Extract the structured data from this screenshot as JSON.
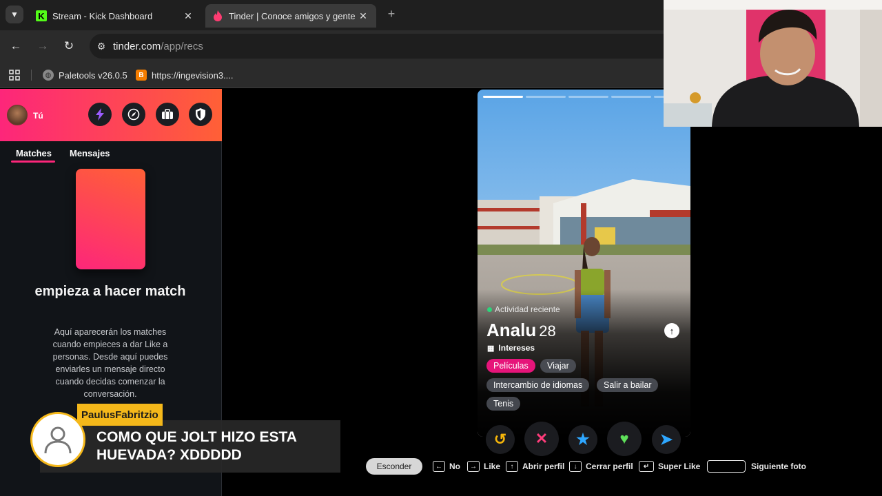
{
  "browser": {
    "tabs": [
      {
        "title": "Stream - Kick Dashboard",
        "favicon": "kick-icon",
        "active": false
      },
      {
        "title": "Tinder | Conoce amigos y gente",
        "favicon": "tinder-flame-icon",
        "active": true
      }
    ],
    "url_domain": "tinder.com",
    "url_path": "/app/recs",
    "bookmarks": [
      {
        "label": "Paletools v26.0.5",
        "icon": "globe-icon"
      },
      {
        "label": "https://ingevision3....",
        "icon": "blogger-icon"
      }
    ]
  },
  "sidebar": {
    "profile_label": "Tú",
    "header_buttons": [
      "boost-icon",
      "explore-icon",
      "briefcase-icon",
      "shield-icon"
    ],
    "tabs": [
      "Matches",
      "Mensajes"
    ],
    "empty_title": "empieza a hacer match",
    "empty_description": "Aquí aparecerán los matches cuando empieces a dar Like a personas. Desde aquí puedes enviarles un mensaje directo cuando decidas comenzar la conversación."
  },
  "card": {
    "activity": "Actividad reciente",
    "name": "Analu",
    "age": "28",
    "interests_label": "Intereses",
    "interests": [
      {
        "label": "Películas",
        "shared": true
      },
      {
        "label": "Viajar",
        "shared": false
      },
      {
        "label": "Intercambio de idiomas",
        "shared": false
      },
      {
        "label": "Salir a bailar",
        "shared": false
      },
      {
        "label": "Tenis",
        "shared": false
      }
    ]
  },
  "actions": [
    {
      "name": "rewind",
      "icon": "rewind-icon",
      "glyph": "↺",
      "color": "#f5b50a"
    },
    {
      "name": "nope",
      "icon": "x-icon",
      "glyph": "✕",
      "color": "#fd3c7a"
    },
    {
      "name": "super-like",
      "icon": "star-icon",
      "glyph": "★",
      "color": "#2ea7ff"
    },
    {
      "name": "like",
      "icon": "heart-icon",
      "glyph": "♥",
      "color": "#5ee05a"
    },
    {
      "name": "boost",
      "icon": "send-icon",
      "glyph": "➤",
      "color": "#2ea7ff"
    }
  ],
  "shortcuts": {
    "hide_label": "Esconder",
    "items": [
      {
        "key": "←",
        "label": "No"
      },
      {
        "key": "→",
        "label": "Like"
      },
      {
        "key": "↑",
        "label": "Abrir perfil"
      },
      {
        "key": "↓",
        "label": "Cerrar perfil"
      },
      {
        "key": "↵",
        "label": "Super Like"
      },
      {
        "key": "",
        "label": "Siguiente foto"
      }
    ]
  },
  "stream_overlay": {
    "chat_user": "PaulusFabritzio",
    "chat_message": "COMO QUE JOLT HIZO ESTA HUEVADA? XDDDDD"
  },
  "colors": {
    "tinder_gradient_start": "#fd267a",
    "tinder_gradient_end": "#ff6036",
    "kick_green": "#53fc18",
    "chat_name_bg": "#f5b81a"
  }
}
